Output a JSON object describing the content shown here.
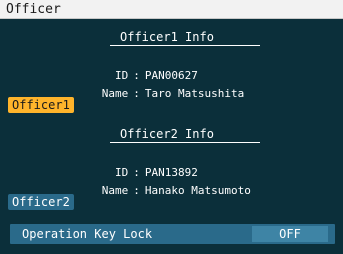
{
  "window": {
    "title": "Officer"
  },
  "officer1": {
    "section_title": "Officer1 Info",
    "id_label": "ID",
    "id_value": "PAN00627",
    "name_label": "Name",
    "name_value": "Taro Matsushita",
    "button_label": "Officer1",
    "selected": true
  },
  "officer2": {
    "section_title": "Officer2 Info",
    "id_label": "ID",
    "id_value": "PAN13892",
    "name_label": "Name",
    "name_value": "Hanako Matsumoto",
    "button_label": "Officer2",
    "selected": false
  },
  "operation_key_lock": {
    "label": "Operation Key Lock",
    "value": "OFF"
  },
  "separator": ":",
  "colors": {
    "background": "#0b2f3a",
    "accent": "#ffb42b",
    "button_inactive": "#2a6a8a"
  }
}
